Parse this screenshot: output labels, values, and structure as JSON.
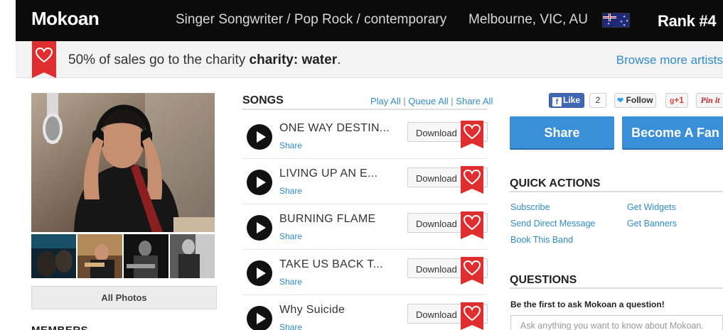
{
  "header": {
    "artist_name": "Mokoan",
    "genre": "Singer Songwriter / Pop Rock / contemporary",
    "location": "Melbourne, VIC, AU",
    "flag_icon": "australia-flag-icon",
    "rank": "Rank #4"
  },
  "charity_bar": {
    "message_prefix": "50% of sales go to the charity",
    "charity_name": "charity: water",
    "message_suffix": ".",
    "browse_link": "Browse more artists",
    "ribbon_color": "#e02d2d"
  },
  "photos": {
    "all_photos_label": "All Photos"
  },
  "members_heading": "MEMBERS",
  "songs": {
    "heading": "SONGS",
    "play_all": "Play All",
    "queue_all": "Queue All",
    "share_all": "Share All",
    "separator": "|",
    "download_label": "Download",
    "share_label": "Share",
    "items": [
      {
        "title": "ONE WAY DESTIN..."
      },
      {
        "title": "LIVING UP AN E..."
      },
      {
        "title": "BURNING FLAME"
      },
      {
        "title": "TAKE US BACK T..."
      },
      {
        "title": "Why Suicide"
      }
    ]
  },
  "social": {
    "fb_like": "Like",
    "fb_count": "2",
    "twitter_follow": "Follow",
    "gplus": "+1",
    "pinit": "Pin it"
  },
  "actions": {
    "share": "Share",
    "become_fan": "Become A Fan"
  },
  "quick_actions": {
    "heading": "QUICK ACTIONS",
    "links": [
      "Subscribe",
      "Get Widgets",
      "Send Direct Message",
      "Get Banners",
      "Book This Band"
    ]
  },
  "questions": {
    "heading": "QUESTIONS",
    "subheading": "Be the first to ask Mokoan a question!",
    "placeholder": "Ask anything you want to know about Mokoan."
  },
  "colors": {
    "accent_blue": "#3a8fd9",
    "link_blue": "#2f8ccc",
    "header_bg": "#0b0b0b"
  }
}
